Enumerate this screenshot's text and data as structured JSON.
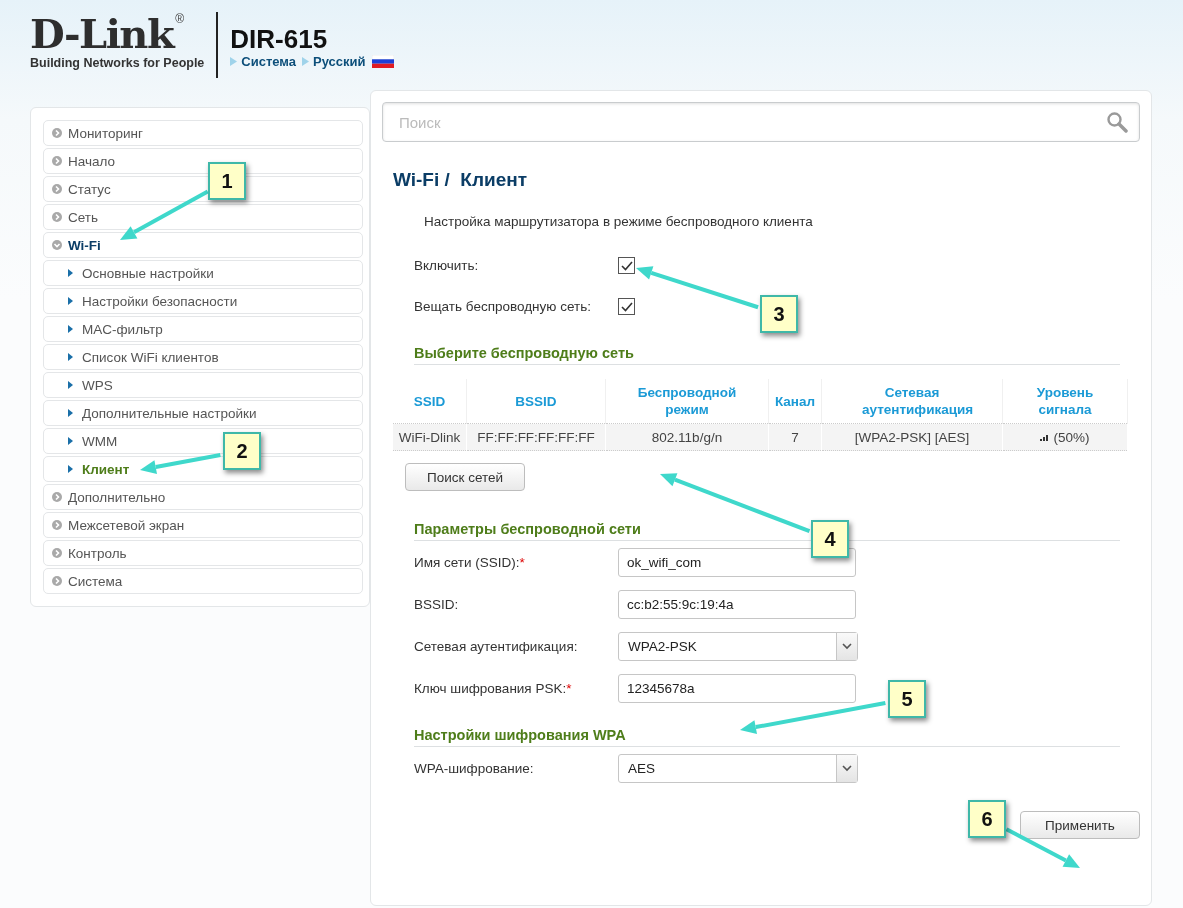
{
  "header": {
    "logo": "D-Link",
    "logo_mark": "®",
    "tagline": "Building Networks for People",
    "model": "DIR-615",
    "breadcrumbs": [
      "Система",
      "Русский"
    ]
  },
  "sidebar": {
    "items": [
      {
        "label": "Мониторинг",
        "selected": false
      },
      {
        "label": "Начало",
        "selected": false
      },
      {
        "label": "Статус",
        "selected": false
      },
      {
        "label": "Сеть",
        "selected": false
      },
      {
        "label": "Wi-Fi",
        "selected": true,
        "expanded": true,
        "children": [
          {
            "label": "Основные настройки",
            "selected": false
          },
          {
            "label": "Настройки безопасности",
            "selected": false
          },
          {
            "label": "MAC-фильтр",
            "selected": false
          },
          {
            "label": "Список WiFi клиентов",
            "selected": false
          },
          {
            "label": "WPS",
            "selected": false
          },
          {
            "label": "Дополнительные настройки",
            "selected": false
          },
          {
            "label": "WMM",
            "selected": false
          },
          {
            "label": "Клиент",
            "selected": true
          }
        ]
      },
      {
        "label": "Дополнительно",
        "selected": false
      },
      {
        "label": "Межсетевой экран",
        "selected": false
      },
      {
        "label": "Контроль",
        "selected": false
      },
      {
        "label": "Система",
        "selected": false
      }
    ]
  },
  "search": {
    "placeholder": "Поиск"
  },
  "page_title": "Wi-Fi /  Клиент",
  "description": "Настройка маршрутизатора в режиме беспроводного клиента",
  "toggles": [
    {
      "label": "Включить:",
      "checked": true
    },
    {
      "label": "Вещать беспроводную сеть:",
      "checked": true
    }
  ],
  "networks": {
    "title": "Выберите беспроводную сеть",
    "columns": [
      "SSID",
      "BSSID",
      "Беспроводной режим",
      "Канал",
      "Сетевая аутентификация",
      "Уровень сигнала"
    ],
    "rows": [
      {
        "cells": [
          "WiFi-Dlink",
          "FF:FF:FF:FF:FF:FF",
          "802.11b/g/n",
          "7",
          "[WPA2-PSK] [AES]",
          "(50%)"
        ]
      }
    ],
    "button": "Поиск сетей"
  },
  "params": {
    "title": "Параметры беспроводной сети",
    "fields": [
      {
        "kind": "text",
        "label": "Имя сети (SSID):",
        "required_mark": "*",
        "value": "ok_wifi_com"
      },
      {
        "kind": "text",
        "label": "BSSID:",
        "value": "cc:b2:55:9c:19:4a"
      },
      {
        "kind": "select",
        "label": "Сетевая аутентификация:",
        "value": "WPA2-PSK"
      },
      {
        "kind": "text",
        "label": "Ключ шифрования PSK:",
        "required_mark": "*",
        "value": "12345678a"
      }
    ]
  },
  "wpa": {
    "title": "Настройки шифрования WPA",
    "fields": [
      {
        "kind": "select",
        "label": "WPA-шифрование:",
        "value": "AES"
      }
    ]
  },
  "apply_button": "Применить",
  "callouts": [
    "1",
    "2",
    "3",
    "4",
    "5",
    "6"
  ]
}
